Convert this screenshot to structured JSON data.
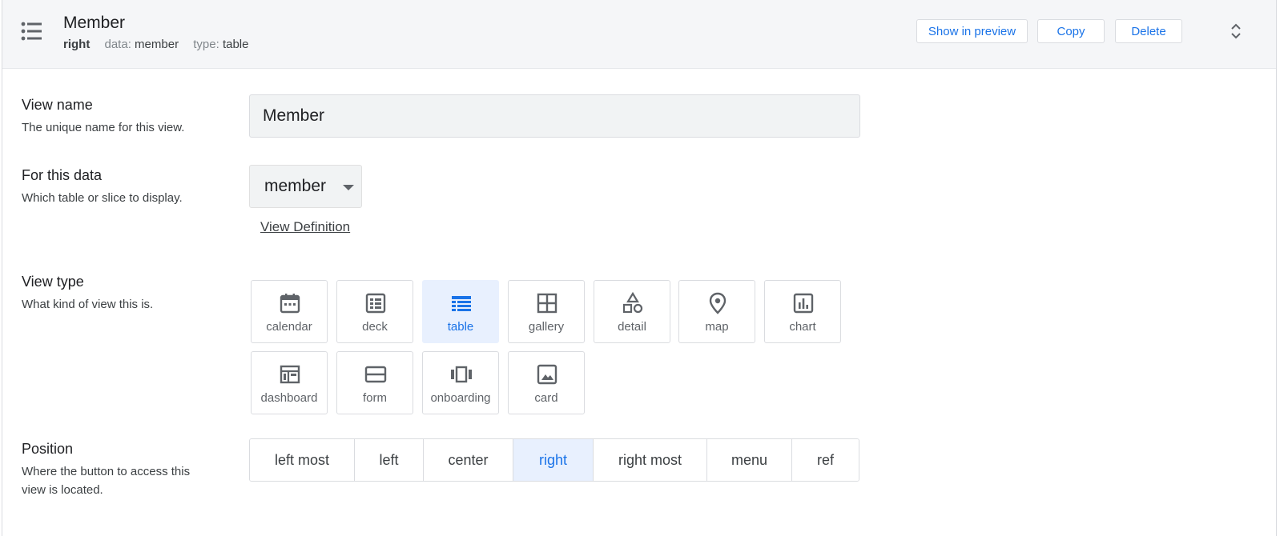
{
  "header": {
    "title": "Member",
    "position": "right",
    "data_label": "data:",
    "data_value": "member",
    "type_label": "type:",
    "type_value": "table",
    "buttons": {
      "show_preview": "Show in preview",
      "copy": "Copy",
      "delete": "Delete"
    },
    "accent_color": "#1a73e8"
  },
  "view_name": {
    "title": "View name",
    "description": "The unique name for this view.",
    "value": "Member"
  },
  "for_data": {
    "title": "For this data",
    "description": "Which table or slice to display.",
    "selected": "member",
    "view_definition": "View Definition"
  },
  "view_type": {
    "title": "View type",
    "description": "What kind of view this is.",
    "options": [
      {
        "label": "calendar",
        "icon": "calendar-icon"
      },
      {
        "label": "deck",
        "icon": "deck-icon"
      },
      {
        "label": "table",
        "icon": "table-icon",
        "selected": true
      },
      {
        "label": "gallery",
        "icon": "gallery-icon"
      },
      {
        "label": "detail",
        "icon": "detail-icon"
      },
      {
        "label": "map",
        "icon": "map-pin-icon"
      },
      {
        "label": "chart",
        "icon": "chart-icon"
      },
      {
        "label": "dashboard",
        "icon": "dashboard-icon"
      },
      {
        "label": "form",
        "icon": "form-icon"
      },
      {
        "label": "onboarding",
        "icon": "onboarding-icon"
      },
      {
        "label": "card",
        "icon": "card-icon"
      }
    ]
  },
  "position": {
    "title": "Position",
    "description_line1": "Where the button to access this",
    "description_line2": "view is located.",
    "options": [
      "left most",
      "left",
      "center",
      "right",
      "right most",
      "menu",
      "ref"
    ],
    "selected": "right"
  }
}
